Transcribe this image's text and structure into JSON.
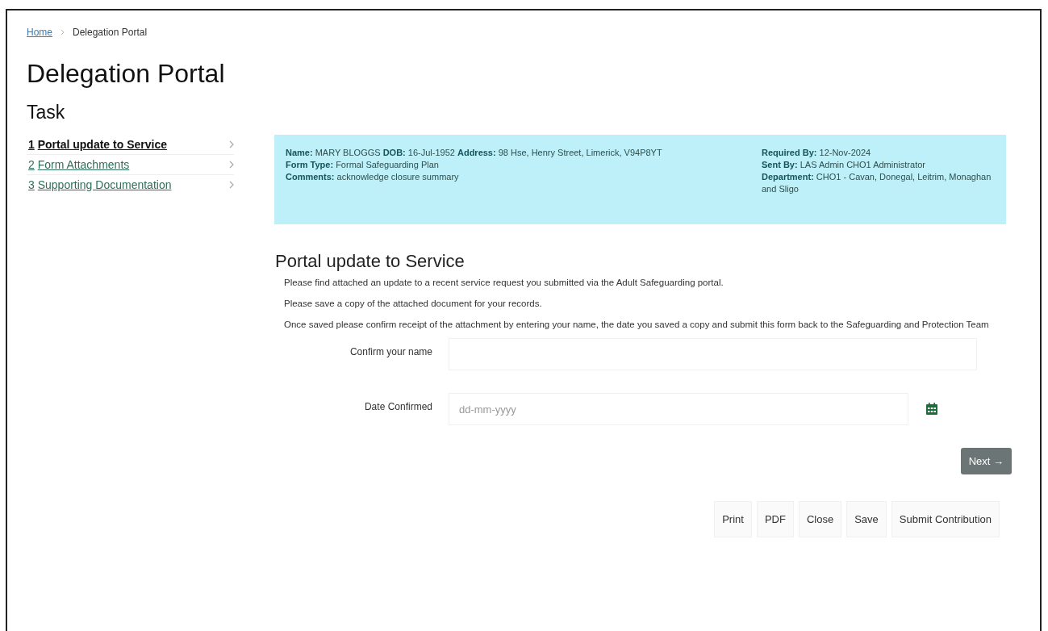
{
  "breadcrumb": [
    {
      "label": "Home",
      "kind": "link"
    },
    {
      "label": "Delegation Portal",
      "kind": "current"
    }
  ],
  "page_title": "Delegation Portal",
  "sidebar": {
    "heading": "Task",
    "items": [
      {
        "number": "1",
        "label": "Portal update to Service",
        "selected": true
      },
      {
        "number": "2",
        "label": "Form Attachments",
        "selected": false
      },
      {
        "number": "3",
        "label": "Supporting Documentation",
        "selected": false
      }
    ]
  },
  "info": {
    "left": [
      "**Name:** MARY BLOGGS **DOB:** 16-Jul-1952 **Address:** 98 Hse, Henry Street, Limerick, V94P8YT",
      "**Form Type:** Formal Safeguarding Plan",
      "**Comments:** acknowledge closure summary"
    ],
    "right": [
      "**Required By:** 12-Nov-2024",
      "**Sent By:** LAS Admin CHO1 Administrator",
      "**Department:** CHO1 - Cavan, Donegal, Leitrim, Monaghan and Sligo"
    ]
  },
  "section_title": "Portal update to Service",
  "paragraphs": [
    "Please find attached an update to a recent service request you submitted via the Adult Safeguarding portal.",
    "Please save a copy of the attached document for your records.",
    "Once saved please confirm receipt of the attachment by entering your name, the date you saved a copy and submit this form back to the Safeguarding and Protection Team"
  ],
  "fields": [
    {
      "kind": "text",
      "label": "Confirm your name"
    },
    {
      "kind": "date",
      "label": "Date Confirmed",
      "placeholder": "dd-mm-yyyy"
    }
  ],
  "next_button": "Next →",
  "footer_buttons": [
    "Print",
    "PDF",
    "Close",
    "Save",
    "Submit Contribution"
  ]
}
